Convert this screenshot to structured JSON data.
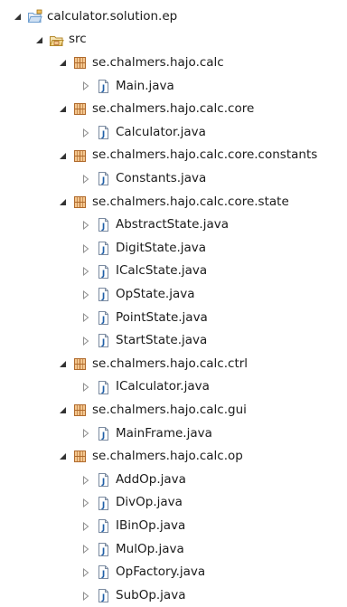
{
  "project": {
    "label": "calculator.solution.ep",
    "icon": "project-folder-icon",
    "expanded": true
  },
  "src_folder": {
    "label": "src",
    "icon": "source-folder-icon",
    "expanded": true
  },
  "packages": [
    {
      "label": "se.chalmers.hajo.calc",
      "icon": "package-icon",
      "expanded": true,
      "files": [
        {
          "label": "Main.java",
          "icon": "java-file-icon"
        }
      ]
    },
    {
      "label": "se.chalmers.hajo.calc.core",
      "icon": "package-icon",
      "expanded": true,
      "files": [
        {
          "label": "Calculator.java",
          "icon": "java-file-icon"
        }
      ]
    },
    {
      "label": "se.chalmers.hajo.calc.core.constants",
      "icon": "package-icon",
      "expanded": true,
      "files": [
        {
          "label": "Constants.java",
          "icon": "java-file-icon"
        }
      ]
    },
    {
      "label": "se.chalmers.hajo.calc.core.state",
      "icon": "package-icon",
      "expanded": true,
      "files": [
        {
          "label": "AbstractState.java",
          "icon": "java-file-icon"
        },
        {
          "label": "DigitState.java",
          "icon": "java-file-icon"
        },
        {
          "label": "ICalcState.java",
          "icon": "java-file-icon"
        },
        {
          "label": "OpState.java",
          "icon": "java-file-icon"
        },
        {
          "label": "PointState.java",
          "icon": "java-file-icon"
        },
        {
          "label": "StartState.java",
          "icon": "java-file-icon"
        }
      ]
    },
    {
      "label": "se.chalmers.hajo.calc.ctrl",
      "icon": "package-icon",
      "expanded": true,
      "files": [
        {
          "label": "ICalculator.java",
          "icon": "java-file-icon"
        }
      ]
    },
    {
      "label": "se.chalmers.hajo.calc.gui",
      "icon": "package-icon",
      "expanded": true,
      "files": [
        {
          "label": "MainFrame.java",
          "icon": "java-file-icon"
        }
      ]
    },
    {
      "label": "se.chalmers.hajo.calc.op",
      "icon": "package-icon",
      "expanded": true,
      "files": [
        {
          "label": "AddOp.java",
          "icon": "java-file-icon"
        },
        {
          "label": "DivOp.java",
          "icon": "java-file-icon"
        },
        {
          "label": "IBinOp.java",
          "icon": "java-file-icon"
        },
        {
          "label": "MulOp.java",
          "icon": "java-file-icon"
        },
        {
          "label": "OpFactory.java",
          "icon": "java-file-icon"
        },
        {
          "label": "SubOp.java",
          "icon": "java-file-icon"
        }
      ]
    }
  ],
  "colors": {
    "expanded_arrow": "#333333",
    "collapsed_arrow": "#8f8f8f",
    "package_brown": "#b06a2c",
    "package_light": "#f3c68e",
    "java_blue": "#1f5fa8",
    "folder_blue": "#6f9fd0"
  }
}
